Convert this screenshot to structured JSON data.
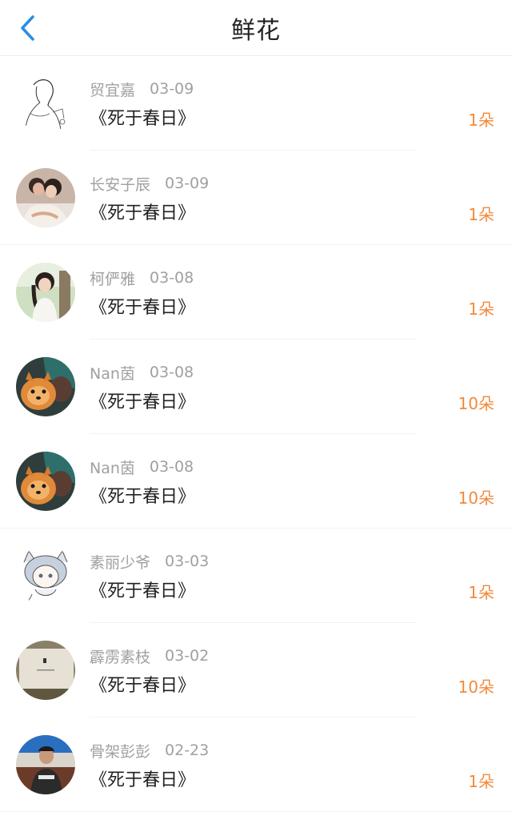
{
  "header": {
    "title": "鲜花"
  },
  "colors": {
    "accent": "#f08a3c",
    "back": "#2a8de3"
  },
  "items": [
    {
      "name": "贸宜嘉",
      "date": "03-09",
      "work": "《死于春日》",
      "count": "1朵",
      "avatar": "sketch"
    },
    {
      "name": "长安子辰",
      "date": "03-09",
      "work": "《死于春日》",
      "count": "1朵",
      "avatar": "couple"
    },
    {
      "name": "柯俨雅",
      "date": "03-08",
      "work": "《死于春日》",
      "count": "1朵",
      "avatar": "girl"
    },
    {
      "name": "Nan茵",
      "date": "03-08",
      "work": "《死于春日》",
      "count": "10朵",
      "avatar": "dog"
    },
    {
      "name": "Nan茵",
      "date": "03-08",
      "work": "《死于春日》",
      "count": "10朵",
      "avatar": "dog"
    },
    {
      "name": "素丽少爷",
      "date": "03-03",
      "work": "《死于春日》",
      "count": "1朵",
      "avatar": "anime"
    },
    {
      "name": "霹雳素枝",
      "date": "03-02",
      "work": "《死于春日》",
      "count": "10朵",
      "avatar": "book"
    },
    {
      "name": "骨架彭彭",
      "date": "02-23",
      "work": "《死于春日》",
      "count": "1朵",
      "avatar": "man"
    }
  ]
}
